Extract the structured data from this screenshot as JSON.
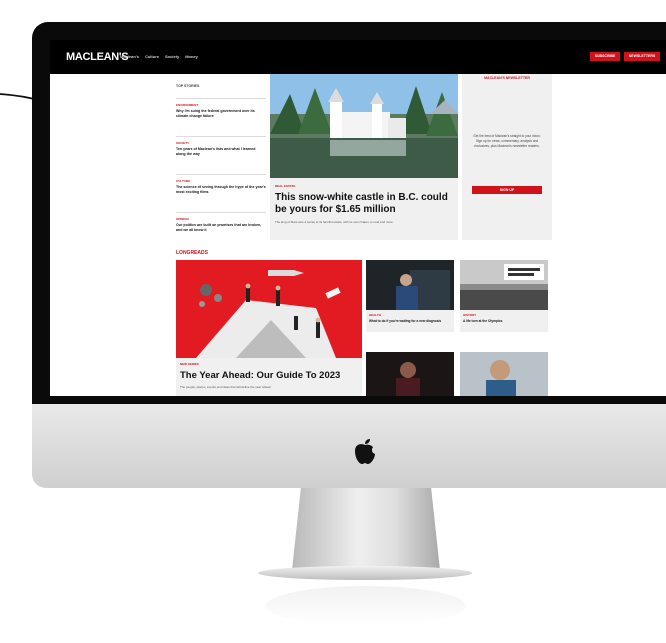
{
  "site": {
    "logo": "MACLEAN'S",
    "nav": [
      "Maclean's",
      "Culture",
      "Society",
      "Money"
    ],
    "cta_primary": "SUBSCRIBE",
    "cta_secondary": "NEWSLETTERS"
  },
  "top_stories": {
    "heading": "TOP STORIES",
    "items": [
      {
        "tag": "ENVIRONMENT",
        "title": "Why I'm suing the federal government over its climate change failure"
      },
      {
        "tag": "SOCIETY",
        "title": "Ten years of Maclean's lists and what I learned along the way"
      },
      {
        "tag": "CULTURE",
        "title": "The science of seeing through the hype of the year's most exciting films"
      },
      {
        "tag": "OPINION",
        "title": "Our politics are built on promises that are broken, and we all know it"
      }
    ]
  },
  "featured": {
    "tag": "REAL ESTATE",
    "title": "This snow-white castle in B.C. could be yours for $1.65 million",
    "desc": "The king of Mars sets a sense to its fanciful estate, with its own chapel, a moat and more."
  },
  "newsletter": {
    "title": "MACLEAN'S NEWSLETTER",
    "text": "Get the best of Maclean's straight to your inbox. Sign up for news, commentary, analysis and exclusives, plus Maclean's newsletter readers.",
    "button": "SIGN UP"
  },
  "longreads": {
    "title": "LONGREADS",
    "main": {
      "tag": "NEW SERIES",
      "title": "The Year Ahead: Our Guide To 2023",
      "desc": "The people, places, events and ideas that will define the year ahead."
    },
    "cards": [
      {
        "tag": "HEALTH",
        "title": "What to do if you're waiting for a new diagnosis"
      },
      {
        "tag": "HISTORY",
        "title": "A life torn at the Olympics"
      },
      {
        "tag": "",
        "title": ""
      },
      {
        "tag": "",
        "title": ""
      }
    ]
  },
  "colors": {
    "accent": "#d0121b",
    "nav_bg": "#000000",
    "bezel": "#0a0a0a",
    "chin": "#d9d9d9"
  },
  "icons": [
    "apple-logo-icon",
    "arrow-annotation-icon"
  ]
}
